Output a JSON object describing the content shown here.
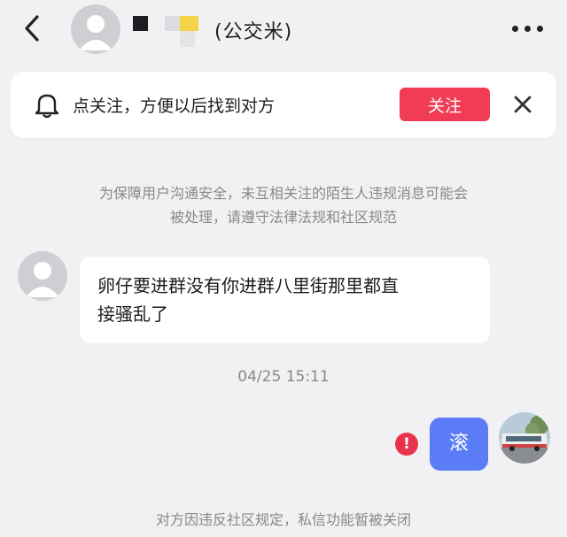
{
  "header": {
    "peer_name": "(公交米)",
    "icons": {
      "back": "back-arrow-icon",
      "more": "more-dots-icon"
    }
  },
  "follow_banner": {
    "text": "点关注，方便以后找到对方",
    "button_label": "关注",
    "icons": {
      "bell": "bell-icon",
      "close": "close-icon"
    },
    "colors": {
      "button": "#f13c55"
    }
  },
  "system_notice": {
    "line1": "为保障用户沟通安全，未互相关注的陌生人违规消息可能会",
    "line2": "被处理，请遵守法律法规和社区规范"
  },
  "messages": [
    {
      "direction": "incoming",
      "text_line1": "卵仔要进群没有你进群八里街那里都直",
      "text_line2": "接骚乱了"
    },
    {
      "direction": "outgoing",
      "text": "滚",
      "status": "failed",
      "status_glyph": "!"
    }
  ],
  "timestamp": "04/25 15:11",
  "blocked_notice": "对方因违反社区规定，私信功能暂被关闭",
  "colors": {
    "background": "#f1f1f3",
    "outgoing_bubble": "#5a7cf7",
    "error": "#e9334d"
  }
}
